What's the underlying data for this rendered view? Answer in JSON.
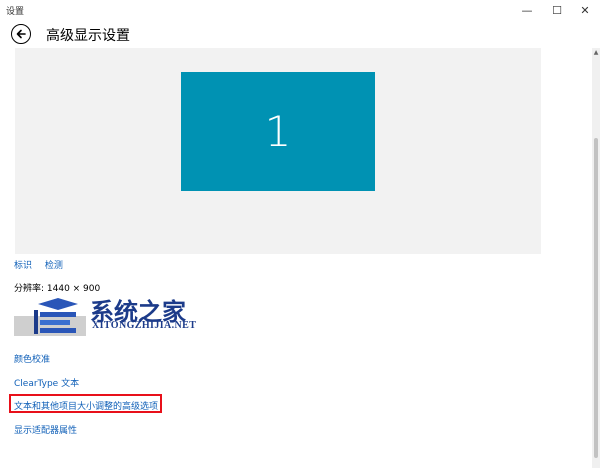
{
  "window": {
    "title": "设置",
    "controls": {
      "minimize": "—",
      "maximize": "☐",
      "close": "✕"
    }
  },
  "header": {
    "title": "高级显示设置"
  },
  "preview": {
    "monitor_label": "1"
  },
  "links": {
    "identify": "标识",
    "detect": "检测"
  },
  "resolution": {
    "label": "分辨率: 1440 × 900"
  },
  "watermark": {
    "title": "系统之家",
    "url": "XITONGZHIJIA.NET"
  },
  "items": [
    {
      "label": "颜色校准"
    },
    {
      "label": "ClearType 文本"
    },
    {
      "label": "文本和其他项目大小调整的高级选项"
    },
    {
      "label": "显示适配器属性"
    }
  ],
  "colors": {
    "accent": "#0092b3",
    "link": "#1060b8",
    "highlight": "#e8101a"
  }
}
